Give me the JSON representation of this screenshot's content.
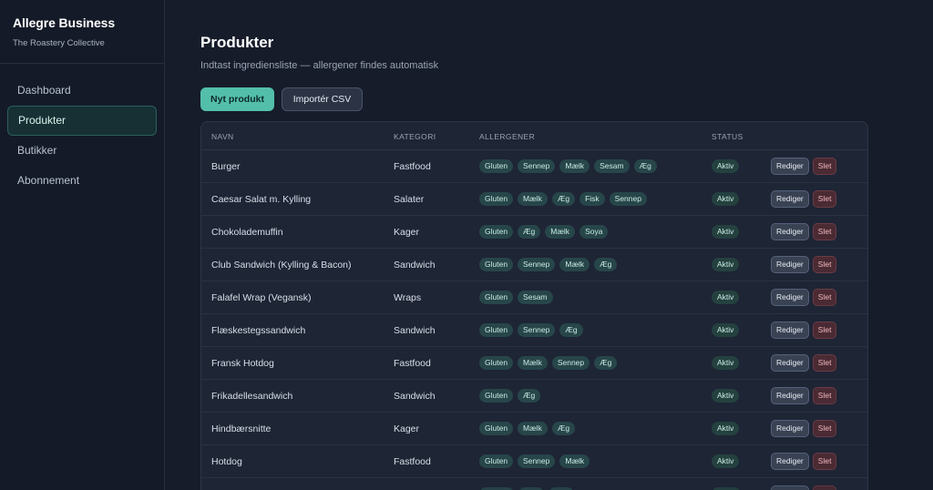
{
  "sidebar": {
    "brand": "Allegre Business",
    "subtitle": "The Roastery Collective",
    "items": [
      {
        "label": "Dashboard"
      },
      {
        "label": "Produkter",
        "active": true
      },
      {
        "label": "Butikker"
      },
      {
        "label": "Abonnement"
      }
    ]
  },
  "page": {
    "title": "Produkter",
    "subtitle": "Indtast ingrediensliste — allergener findes automatisk"
  },
  "toolbar": {
    "new_label": "Nyt produkt",
    "import_label": "Importér CSV"
  },
  "table": {
    "headers": {
      "name": "NAVN",
      "category": "KATEGORI",
      "allergens": "ALLERGENER",
      "status": "STATUS"
    },
    "action_labels": {
      "edit": "Rediger",
      "delete": "Slet"
    },
    "rows": [
      {
        "name": "Burger",
        "category": "Fastfood",
        "allergens": [
          "Gluten",
          "Sennep",
          "Mælk",
          "Sesam",
          "Æg"
        ],
        "status": "Aktiv"
      },
      {
        "name": "Caesar Salat m. Kylling",
        "category": "Salater",
        "allergens": [
          "Gluten",
          "Mælk",
          "Æg",
          "Fisk",
          "Sennep"
        ],
        "status": "Aktiv"
      },
      {
        "name": "Chokolademuffin",
        "category": "Kager",
        "allergens": [
          "Gluten",
          "Æg",
          "Mælk",
          "Soya"
        ],
        "status": "Aktiv"
      },
      {
        "name": "Club Sandwich (Kylling & Bacon)",
        "category": "Sandwich",
        "allergens": [
          "Gluten",
          "Sennep",
          "Mælk",
          "Æg"
        ],
        "status": "Aktiv"
      },
      {
        "name": "Falafel Wrap (Vegansk)",
        "category": "Wraps",
        "allergens": [
          "Gluten",
          "Sesam"
        ],
        "status": "Aktiv"
      },
      {
        "name": "Flæskestegssandwich",
        "category": "Sandwich",
        "allergens": [
          "Gluten",
          "Sennep",
          "Æg"
        ],
        "status": "Aktiv"
      },
      {
        "name": "Fransk Hotdog",
        "category": "Fastfood",
        "allergens": [
          "Gluten",
          "Mælk",
          "Sennep",
          "Æg"
        ],
        "status": "Aktiv"
      },
      {
        "name": "Frikadellesandwich",
        "category": "Sandwich",
        "allergens": [
          "Gluten",
          "Æg"
        ],
        "status": "Aktiv"
      },
      {
        "name": "Hindbærsnitte",
        "category": "Kager",
        "allergens": [
          "Gluten",
          "Mælk",
          "Æg"
        ],
        "status": "Aktiv"
      },
      {
        "name": "Hotdog",
        "category": "Fastfood",
        "allergens": [
          "Gluten",
          "Sennep",
          "Mælk"
        ],
        "status": "Aktiv"
      },
      {
        "name": "",
        "category": "",
        "allergens": [
          "",
          "",
          ""
        ],
        "status": ""
      }
    ]
  }
}
